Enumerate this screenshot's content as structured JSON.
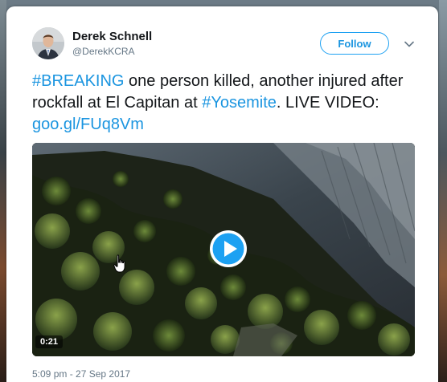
{
  "tweet": {
    "author": {
      "display_name": "Derek Schnell",
      "handle": "@DerekKCRA",
      "avatar_icon": "avatar-portrait"
    },
    "follow_label": "Follow",
    "menu_icon": "chevron-down-icon",
    "text_parts": [
      {
        "text": "#BREAKING",
        "type": "hashtag"
      },
      {
        "text": " one person killed, another injured after rockfall at El Capitan at ",
        "type": "text"
      },
      {
        "text": "#Yosemite",
        "type": "hashtag"
      },
      {
        "text": ". LIVE VIDEO: ",
        "type": "text"
      },
      {
        "text": "goo.gl/FUq8Vm",
        "type": "link"
      }
    ],
    "media": {
      "type": "video",
      "duration": "0:21",
      "play_icon": "play-icon"
    },
    "timestamp": "5:09 pm - 27 Sep 2017"
  },
  "colors": {
    "accent": "#1da1f2",
    "link": "#1b95e0",
    "text": "#14171a",
    "muted": "#657786"
  }
}
